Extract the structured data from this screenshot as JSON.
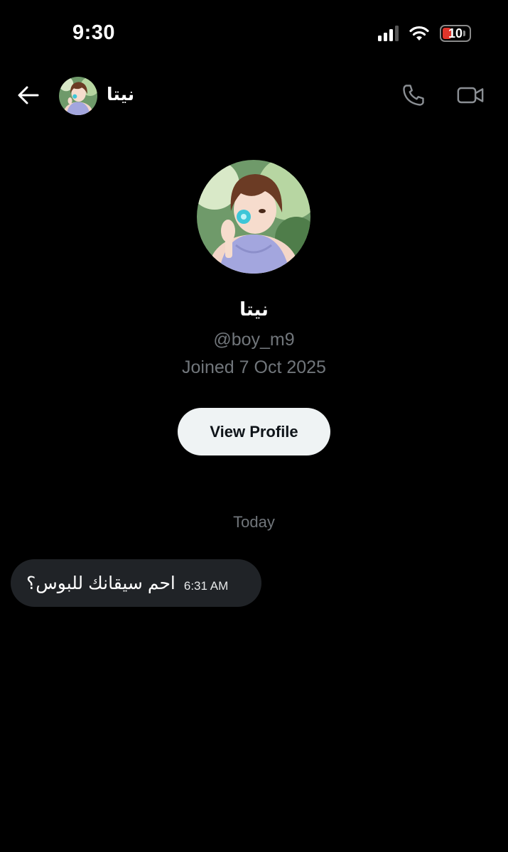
{
  "status_bar": {
    "time": "9:30",
    "battery_level": "10",
    "signal_icon": "signal-bars-icon",
    "wifi_icon": "wifi-icon",
    "battery_icon": "battery-icon",
    "battery_color": "#e0352b"
  },
  "header": {
    "back_icon": "back-arrow-icon",
    "name": "نيتا",
    "call_icon": "phone-icon",
    "video_icon": "video-camera-icon"
  },
  "profile": {
    "name": "نيتا",
    "handle": "@boy_m9",
    "joined": "Joined 7 Oct 2025",
    "view_profile_label": "View Profile"
  },
  "conversation": {
    "date_divider": "Today",
    "messages": [
      {
        "text": "احم سيقانك للبوس؟",
        "time": "6:31 AM"
      }
    ]
  },
  "colors": {
    "background": "#000000",
    "muted_text": "#71767b",
    "bubble": "#202327",
    "button_bg": "#eff3f4"
  }
}
